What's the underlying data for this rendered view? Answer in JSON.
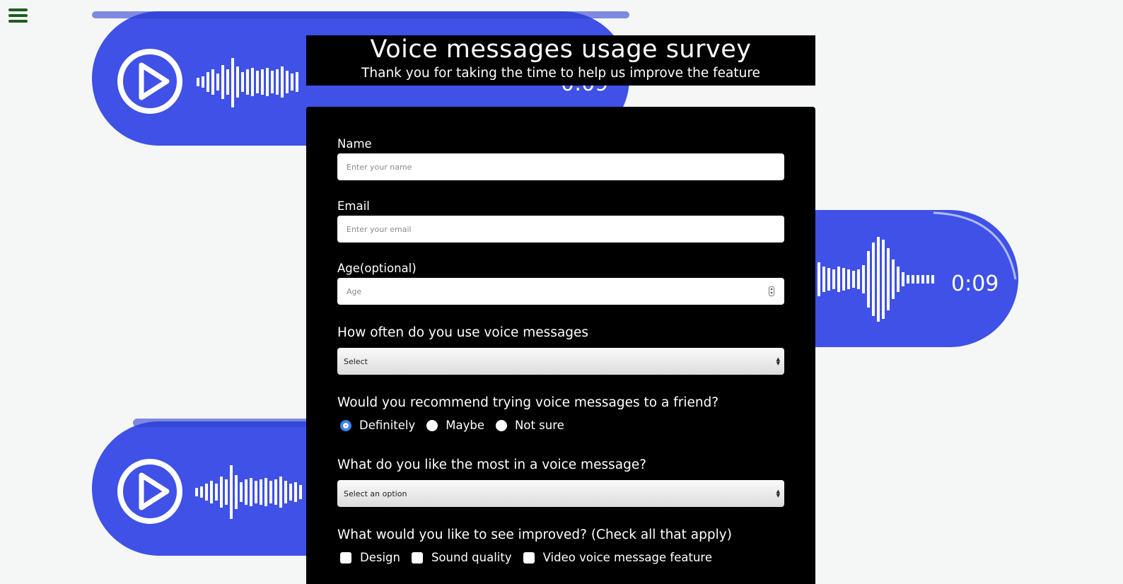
{
  "nav": {
    "menu_icon": "hamburger-menu-icon"
  },
  "background": {
    "bubble_color": "#3f51e6",
    "bubble_duration": "0:09"
  },
  "header": {
    "title": "Voice messages usage survey",
    "subtitle": "Thank you for taking the time to help us improve the feature"
  },
  "form": {
    "name": {
      "label": "Name",
      "placeholder": "Enter your name"
    },
    "email": {
      "label": "Email",
      "placeholder": "Enter your email"
    },
    "age": {
      "label": "Age(optional)",
      "placeholder": "Age"
    },
    "frequency": {
      "question": "How often do you use voice messages",
      "selected": "Select"
    },
    "recommend": {
      "question": "Would you recommend trying voice messages to a friend?",
      "options": [
        "Definitely",
        "Maybe",
        "Not sure"
      ],
      "selected": "Definitely"
    },
    "like_most": {
      "question": "What do you like the most in a voice message?",
      "selected": "Select an option"
    },
    "improve": {
      "question": "What would you like to see improved? (Check all that apply)",
      "options": [
        "Design",
        "Sound quality",
        "Video voice message feature"
      ]
    }
  }
}
